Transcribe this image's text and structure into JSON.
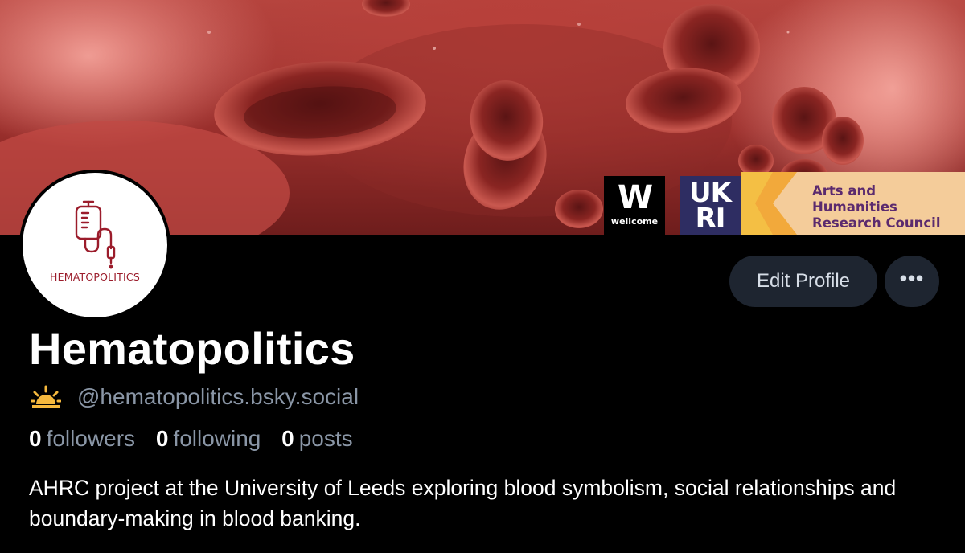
{
  "banner": {
    "sponsors": {
      "wellcome": {
        "mark": "W",
        "name": "wellcome"
      },
      "ukri": {
        "line1": "UK",
        "line2": "RI"
      },
      "ahrc": {
        "lines": [
          "Arts and",
          "Humanities",
          "Research Council"
        ]
      }
    }
  },
  "avatar": {
    "logo_text": "HEMATOPOLITICS"
  },
  "actions": {
    "edit_profile_label": "Edit Profile",
    "more_label": "•••"
  },
  "profile": {
    "display_name": "Hematopolitics",
    "handle": "@hematopolitics.bsky.social",
    "handle_icon": "sunrise-icon",
    "stats": {
      "followers_count": "0",
      "followers_label": "followers",
      "following_count": "0",
      "following_label": "following",
      "posts_count": "0",
      "posts_label": "posts"
    },
    "bio": "AHRC project at the University of Leeds exploring blood symbolism, social relationships and boundary-making in blood banking."
  },
  "colors": {
    "background": "#000000",
    "button_bg": "#1e2530",
    "muted_text": "#8a96a6",
    "brand_red": "#9b1c2b",
    "sun_icon": "#f5b83d"
  }
}
